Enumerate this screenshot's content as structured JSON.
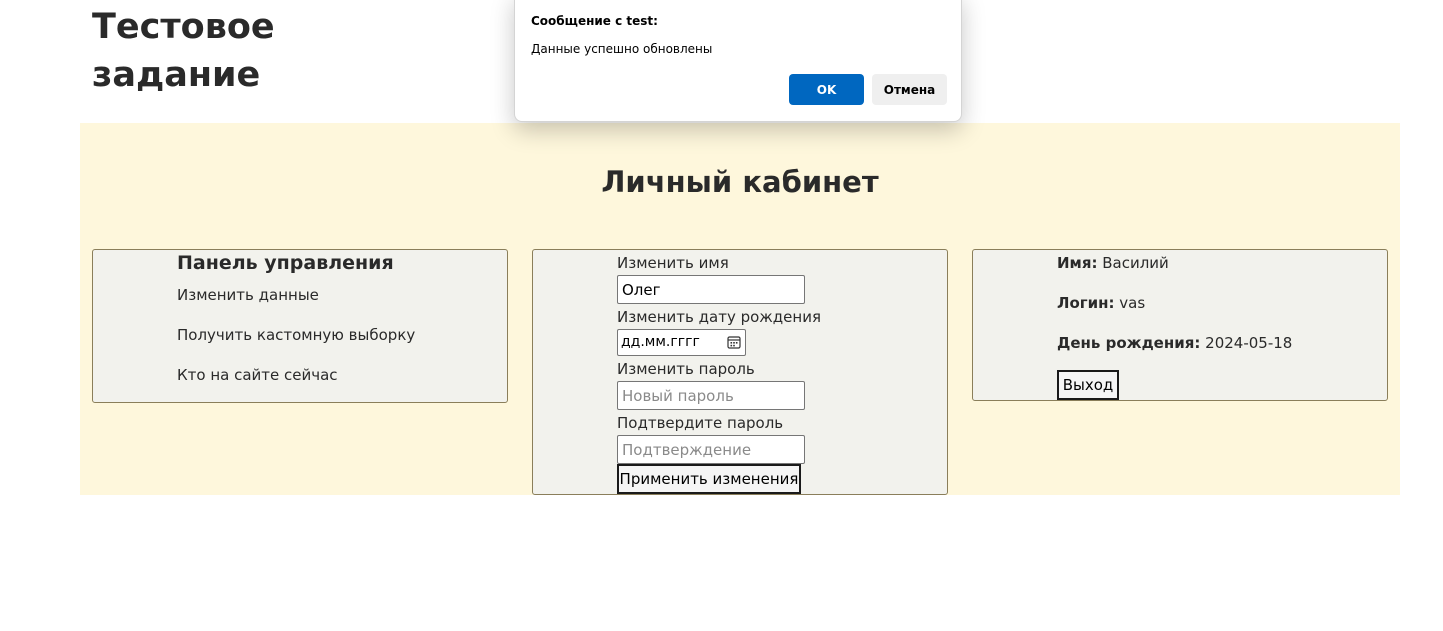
{
  "site": {
    "title": "Тестовое задание"
  },
  "main": {
    "heading": "Личный кабинет"
  },
  "control_panel": {
    "heading": "Панель управления",
    "items": [
      {
        "label": "Изменить данные"
      },
      {
        "label": "Получить кастомную выборку"
      },
      {
        "label": "Кто на сайте сейчас"
      }
    ]
  },
  "edit_form": {
    "name_label": "Изменить имя",
    "name_value": "Олег",
    "birthdate_label": "Изменить дату рождения",
    "birthdate_placeholder": "дд.мм.гггг",
    "password_label": "Изменить пароль",
    "password_placeholder": "Новый пароль",
    "confirm_label": "Подтвердите пароль",
    "confirm_placeholder": "Подтверждение",
    "apply_label": "Применить изменения"
  },
  "profile": {
    "name_key": "Имя:",
    "name_value": "Василий",
    "login_key": "Логин:",
    "login_value": "vas",
    "birthday_key": "День рождения:",
    "birthday_value": "2024-05-18",
    "logout_label": "Выход"
  },
  "dialog": {
    "title": "Сообщение с test:",
    "message": "Данные успешно обновлены",
    "ok_label": "OK",
    "cancel_label": "Отмена"
  },
  "icons": {
    "calendar": "calendar-icon"
  },
  "colors": {
    "section_background": "#fef7dc",
    "panel_background": "#f2f2ed",
    "dialog_ok": "#0067c0"
  }
}
